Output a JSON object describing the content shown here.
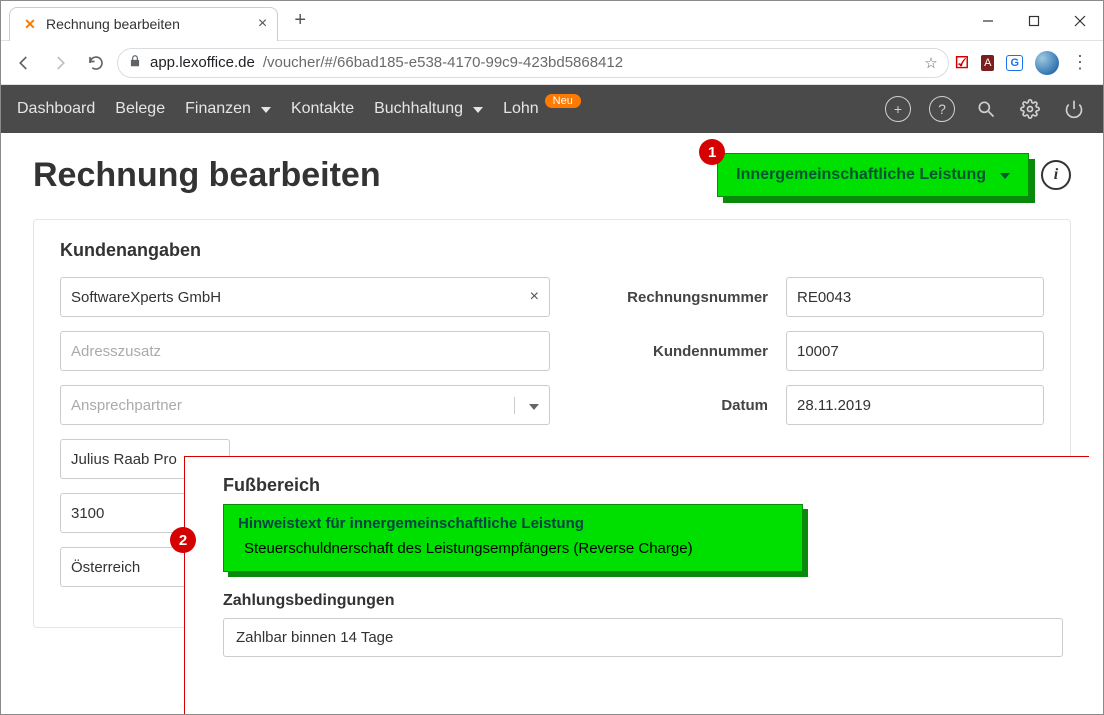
{
  "browser": {
    "tab_title": "Rechnung bearbeiten",
    "url_domain": "app.lexoffice.de",
    "url_path": "/voucher/#/66bad185-e538-4170-99c9-423bd5868412"
  },
  "appnav": {
    "dashboard": "Dashboard",
    "belege": "Belege",
    "finanzen": "Finanzen",
    "kontakte": "Kontakte",
    "buchhaltung": "Buchhaltung",
    "lohn": "Lohn",
    "lohn_badge": "Neu"
  },
  "page": {
    "title": "Rechnung bearbeiten",
    "type_dropdown": "Innergemeinschaftliche Leistung"
  },
  "markers": {
    "m1": "1",
    "m2": "2"
  },
  "customer": {
    "section_title": "Kundenangaben",
    "company": "SoftwareXperts GmbH",
    "address_supplement_placeholder": "Adresszusatz",
    "contact_placeholder": "Ansprechpartner",
    "street": "Julius Raab Pro",
    "zip": "3100",
    "country": "Österreich",
    "labels": {
      "invoice_no": "Rechnungsnummer",
      "customer_no": "Kundennummer",
      "date": "Datum"
    },
    "invoice_no": "RE0043",
    "customer_no": "10007",
    "date": "28.11.2019"
  },
  "footer": {
    "section_title": "Fußbereich",
    "hint_title": "Hinweistext für innergemeinschaftliche Leistung",
    "hint_body": "Steuerschuldnerschaft des Leistungsempfängers (Reverse Charge)",
    "payment_title": "Zahlungsbedingungen",
    "payment_body": "Zahlbar binnen 14 Tage"
  }
}
